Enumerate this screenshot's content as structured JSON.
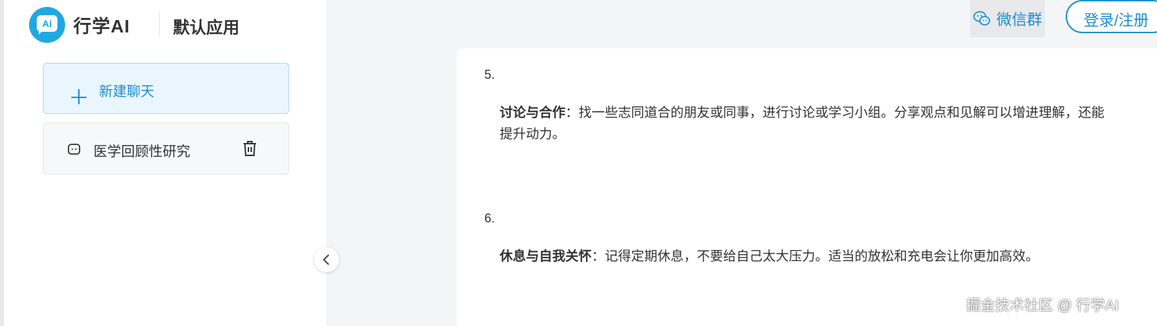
{
  "header": {
    "logo_text": "Ai",
    "brand": "行学AI",
    "app_name": "默认应用",
    "wechat_label": "微信群",
    "login_label": "登录/注册"
  },
  "sidebar": {
    "new_chat_label": "新建聊天",
    "chats": [
      {
        "title": "医学回顾性研究"
      }
    ]
  },
  "content": {
    "items": [
      {
        "number": "5.",
        "bold": "讨论与合作",
        "text": "：找一些志同道合的朋友或同事，进行讨论或学习小组。分享观点和见解可以增进理解，还能提升动力。"
      },
      {
        "number": "6.",
        "bold": "休息与自我关怀",
        "text": "：记得定期休息，不要给自己太大压力。适当的放松和充电会让你更加高效。"
      }
    ]
  },
  "watermark": "掘金技术社区 @ 行学AI",
  "colors": {
    "accent": "#1d8fd3",
    "logo": "#1fa9e0",
    "new_chat_bg": "#e9f6fd"
  },
  "icons": {
    "new_chat": "plus-icon",
    "chat": "chat-bubble-icon",
    "delete": "trash-icon",
    "collapse": "chevron-left-icon",
    "wechat": "wechat-icon"
  }
}
